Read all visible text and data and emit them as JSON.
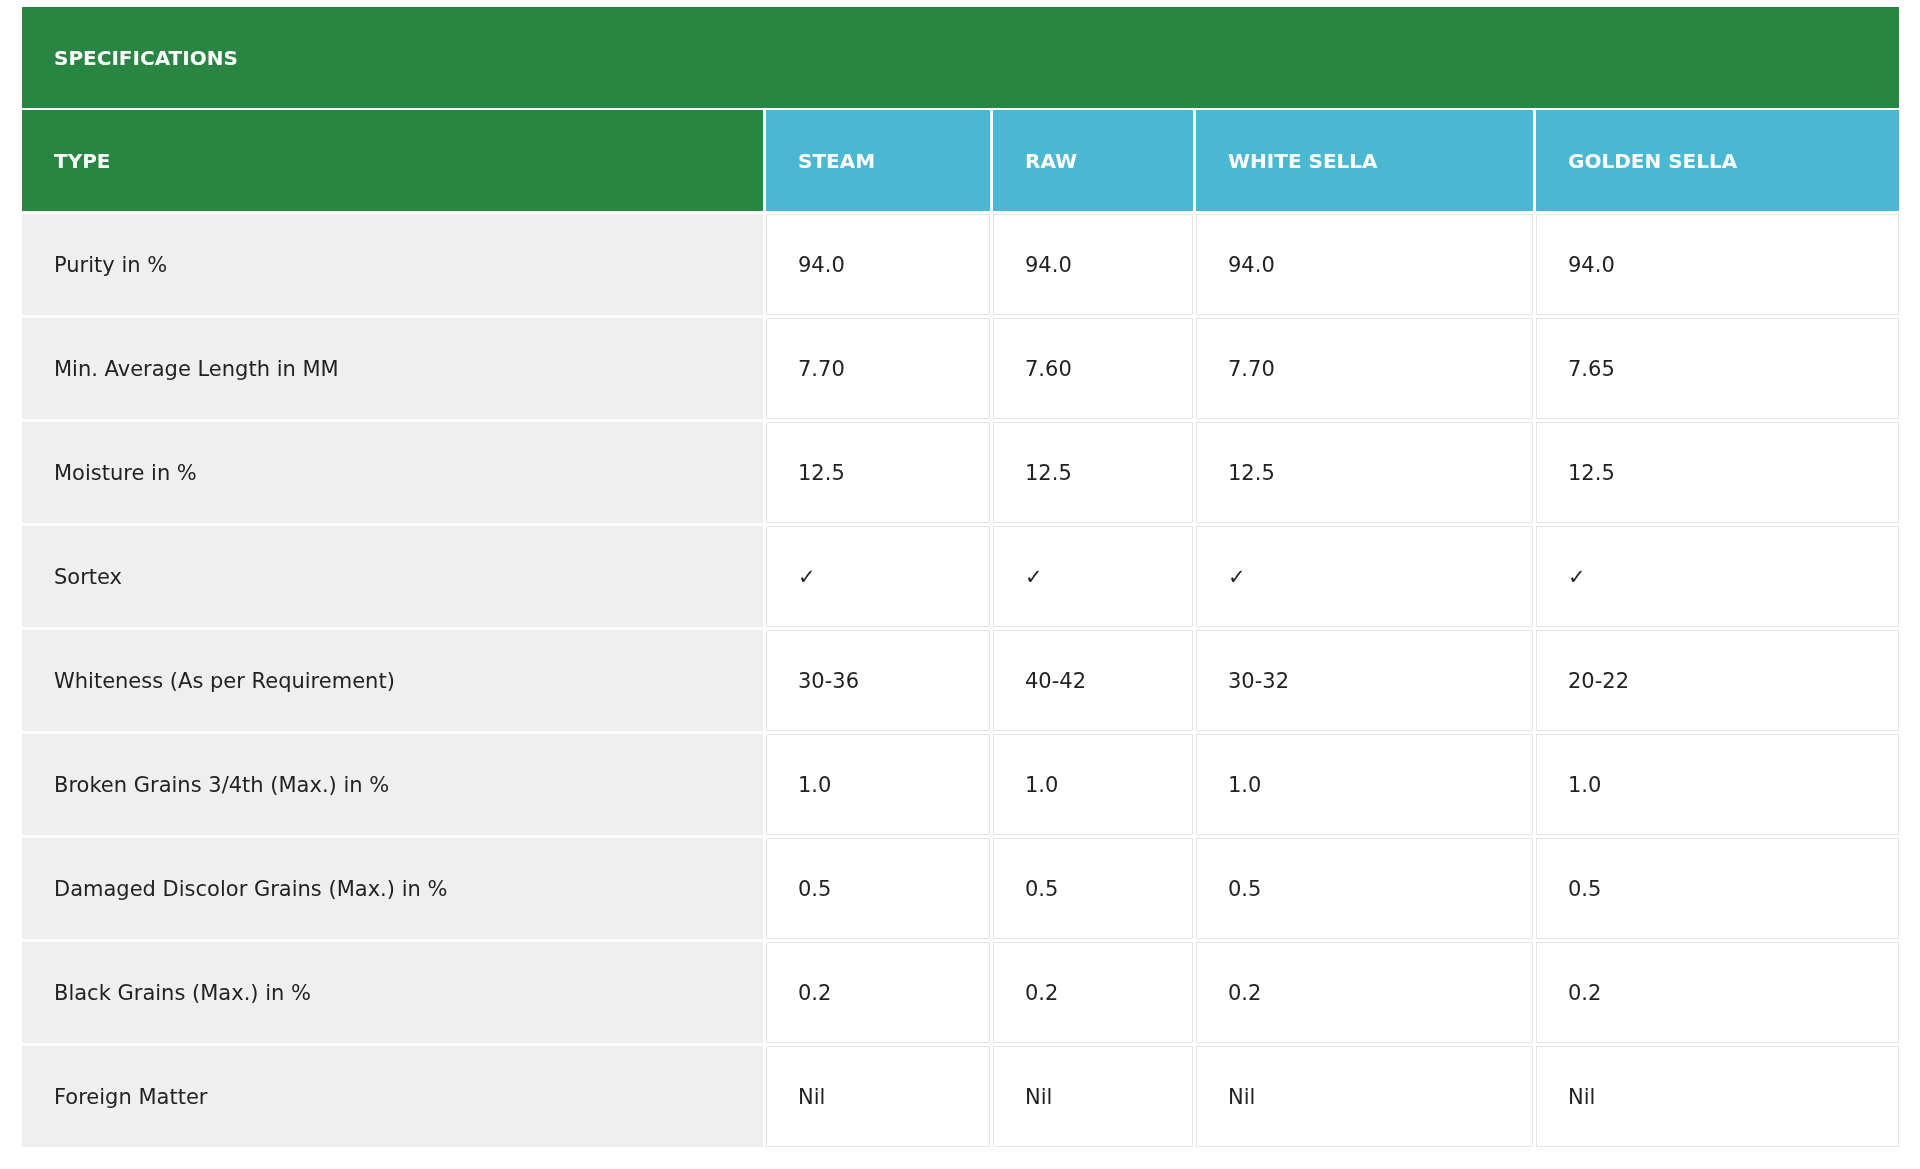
{
  "table": {
    "title": "SPECIFICATIONS",
    "columns": [
      {
        "label": "TYPE",
        "kind": "type"
      },
      {
        "label": "STEAM",
        "kind": "variant"
      },
      {
        "label": "RAW",
        "kind": "variant"
      },
      {
        "label": "WHITE SELLA",
        "kind": "variant"
      },
      {
        "label": "GOLDEN SELLA",
        "kind": "variant"
      }
    ],
    "rows": [
      {
        "label": "Purity in %",
        "values": [
          "94.0",
          "94.0",
          "94.0",
          "94.0"
        ]
      },
      {
        "label": "Min. Average Length in MM",
        "values": [
          "7.70",
          "7.60",
          "7.70",
          "7.65"
        ]
      },
      {
        "label": "Moisture in %",
        "values": [
          "12.5",
          "12.5",
          "12.5",
          "12.5"
        ]
      },
      {
        "label": "Sortex",
        "values": [
          "✓",
          "✓",
          "✓",
          "✓"
        ]
      },
      {
        "label": "Whiteness (As per Requirement)",
        "values": [
          "30-36",
          "40-42",
          "30-32",
          "20-22"
        ]
      },
      {
        "label": "Broken Grains 3/4th (Max.) in %",
        "values": [
          "1.0",
          "1.0",
          "1.0",
          "1.0"
        ]
      },
      {
        "label": "Damaged Discolor Grains (Max.) in %",
        "values": [
          "0.5",
          "0.5",
          "0.5",
          "0.5"
        ]
      },
      {
        "label": "Black Grains (Max.) in %",
        "values": [
          "0.2",
          "0.2",
          "0.2",
          "0.2"
        ]
      },
      {
        "label": "Foreign Matter",
        "values": [
          "Nil",
          "Nil",
          "Nil",
          "Nil"
        ]
      }
    ]
  }
}
